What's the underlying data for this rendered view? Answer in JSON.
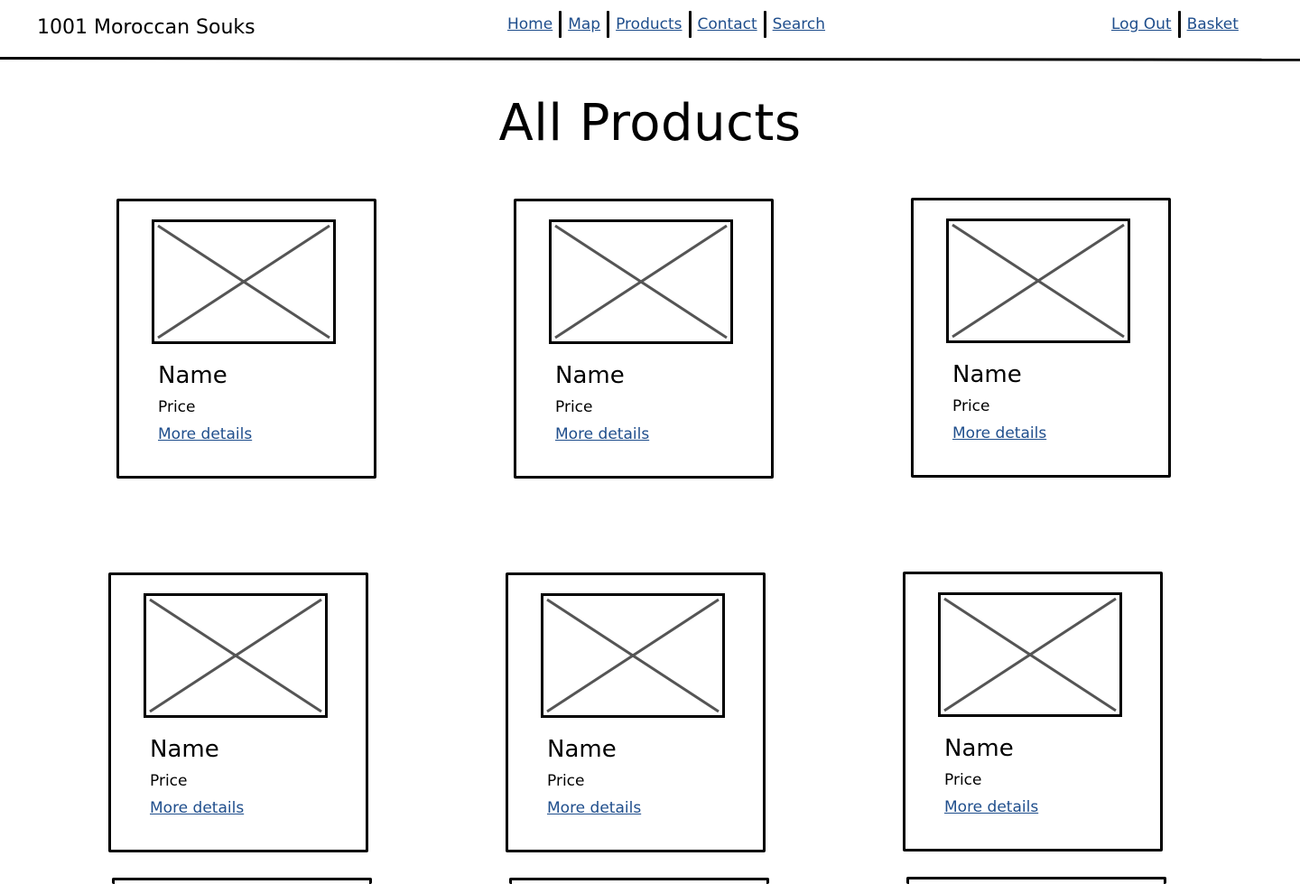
{
  "header": {
    "brand": "1001 Moroccan Souks",
    "nav": [
      "Home",
      "Map",
      "Products",
      "Contact",
      "Search"
    ],
    "account": [
      "Log Out",
      "Basket"
    ]
  },
  "main": {
    "title": "All Products",
    "products": [
      {
        "name": "Name",
        "price": "Price",
        "link": "More details"
      },
      {
        "name": "Name",
        "price": "Price",
        "link": "More details"
      },
      {
        "name": "Name",
        "price": "Price",
        "link": "More details"
      },
      {
        "name": "Name",
        "price": "Price",
        "link": "More details"
      },
      {
        "name": "Name",
        "price": "Price",
        "link": "More details"
      },
      {
        "name": "Name",
        "price": "Price",
        "link": "More details"
      }
    ]
  },
  "colors": {
    "link": "#1f4e8c",
    "border": "#000000",
    "placeholder_cross": "#555555"
  }
}
